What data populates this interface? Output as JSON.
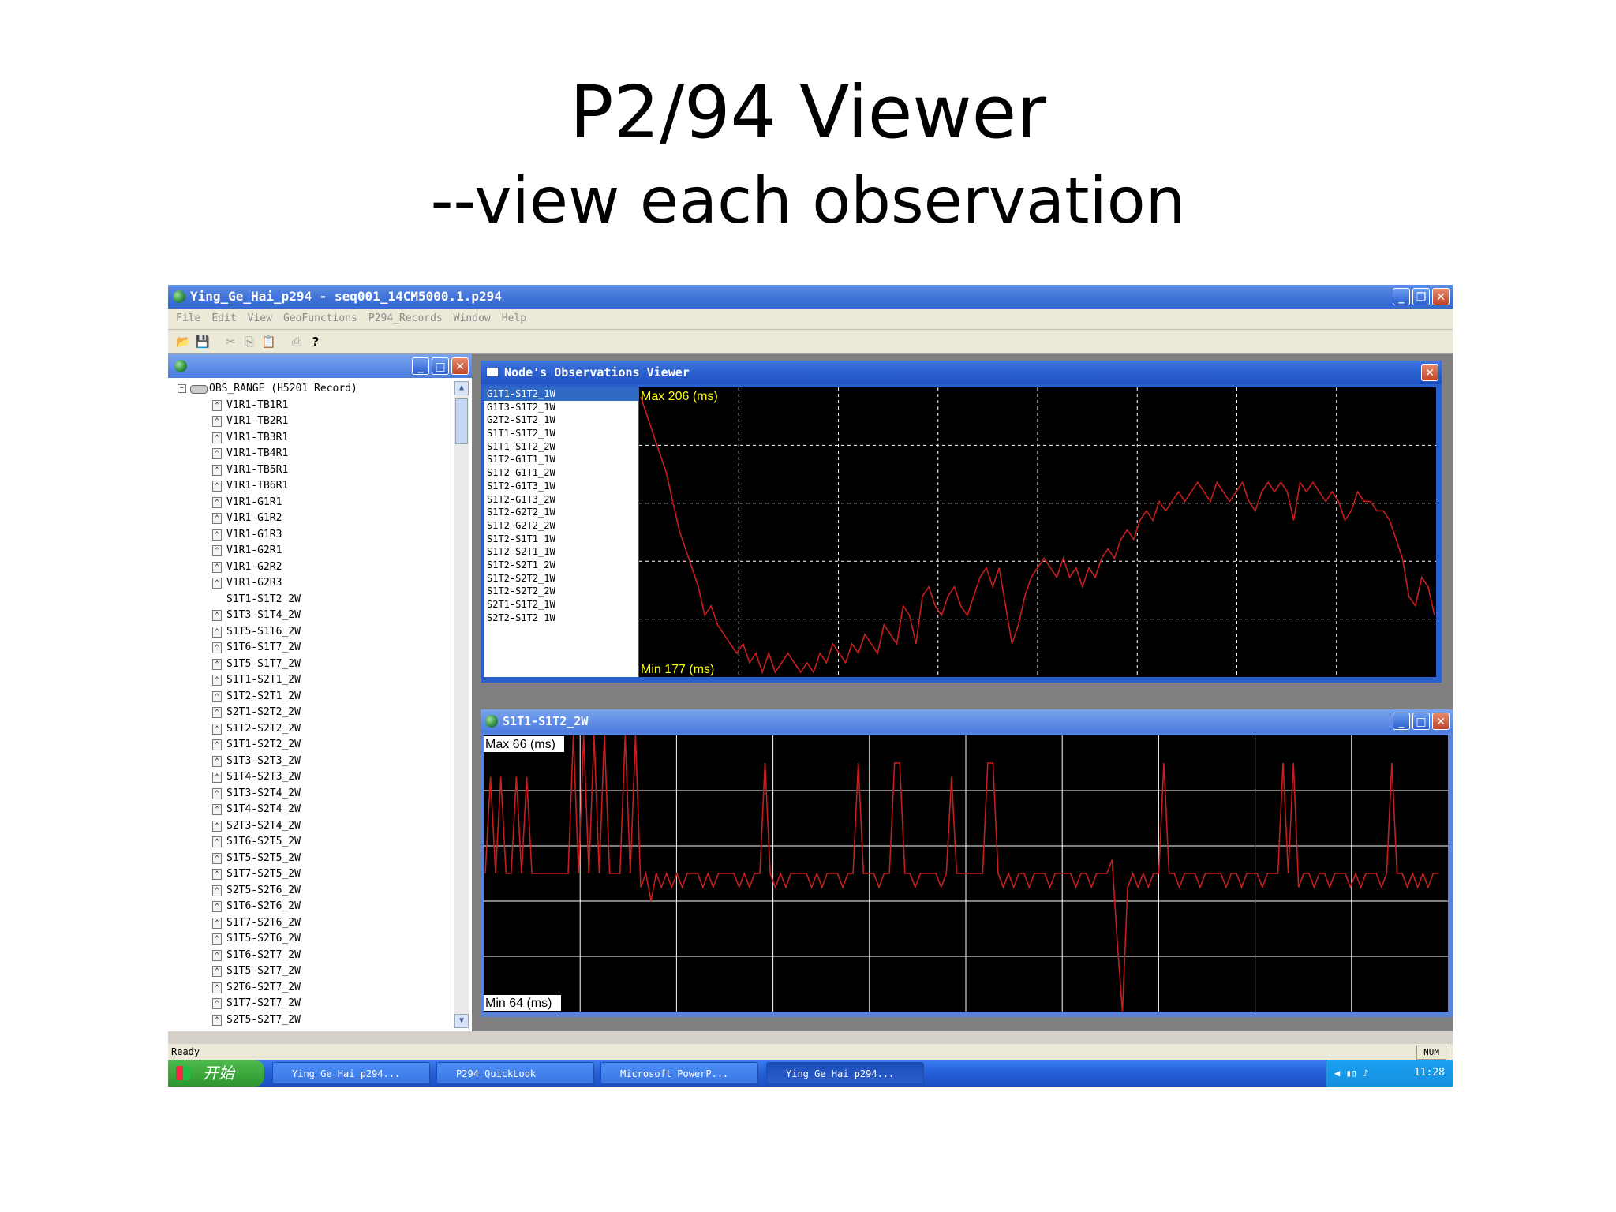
{
  "slide": {
    "title": "P2/94 Viewer",
    "subtitle": "--view each observation"
  },
  "app": {
    "title": "Ying_Ge_Hai_p294 - seq001_14CM5000.1.p294",
    "menu": [
      "File",
      "Edit",
      "View",
      "GeoFunctions",
      "P294_Records",
      "Window",
      "Help"
    ],
    "status": "Ready",
    "status_indicator": "NUM"
  },
  "tree": {
    "root": "OBS_RANGE (H5201 Record)",
    "items": [
      {
        "label": "V1R1-TB1R1",
        "icon": true
      },
      {
        "label": "V1R1-TB2R1",
        "icon": true
      },
      {
        "label": "V1R1-TB3R1",
        "icon": true
      },
      {
        "label": "V1R1-TB4R1",
        "icon": true
      },
      {
        "label": "V1R1-TB5R1",
        "icon": true
      },
      {
        "label": "V1R1-TB6R1",
        "icon": true
      },
      {
        "label": "V1R1-G1R1",
        "icon": true
      },
      {
        "label": "V1R1-G1R2",
        "icon": true
      },
      {
        "label": "V1R1-G1R3",
        "icon": true
      },
      {
        "label": "V1R1-G2R1",
        "icon": true
      },
      {
        "label": "V1R1-G2R2",
        "icon": true
      },
      {
        "label": "V1R1-G2R3",
        "icon": true
      },
      {
        "label": "S1T1-S1T2_2W",
        "icon": false
      },
      {
        "label": "S1T3-S1T4_2W",
        "icon": true
      },
      {
        "label": "S1T5-S1T6_2W",
        "icon": true
      },
      {
        "label": "S1T6-S1T7_2W",
        "icon": true
      },
      {
        "label": "S1T5-S1T7_2W",
        "icon": true
      },
      {
        "label": "S1T1-S2T1_2W",
        "icon": true
      },
      {
        "label": "S1T2-S2T1_2W",
        "icon": true
      },
      {
        "label": "S2T1-S2T2_2W",
        "icon": true
      },
      {
        "label": "S1T2-S2T2_2W",
        "icon": true
      },
      {
        "label": "S1T1-S2T2_2W",
        "icon": true
      },
      {
        "label": "S1T3-S2T3_2W",
        "icon": true
      },
      {
        "label": "S1T4-S2T3_2W",
        "icon": true
      },
      {
        "label": "S1T3-S2T4_2W",
        "icon": true
      },
      {
        "label": "S1T4-S2T4_2W",
        "icon": true
      },
      {
        "label": "S2T3-S2T4_2W",
        "icon": true
      },
      {
        "label": "S1T6-S2T5_2W",
        "icon": true
      },
      {
        "label": "S1T5-S2T5_2W",
        "icon": true
      },
      {
        "label": "S1T7-S2T5_2W",
        "icon": true
      },
      {
        "label": "S2T5-S2T6_2W",
        "icon": true
      },
      {
        "label": "S1T6-S2T6_2W",
        "icon": true
      },
      {
        "label": "S1T7-S2T6_2W",
        "icon": true
      },
      {
        "label": "S1T5-S2T6_2W",
        "icon": true
      },
      {
        "label": "S1T6-S2T7_2W",
        "icon": true
      },
      {
        "label": "S1T5-S2T7_2W",
        "icon": true
      },
      {
        "label": "S2T6-S2T7_2W",
        "icon": true
      },
      {
        "label": "S1T7-S2T7_2W",
        "icon": true
      },
      {
        "label": "S2T5-S2T7_2W",
        "icon": true
      }
    ]
  },
  "node_viewer": {
    "title": "Node's Observations Viewer",
    "list": [
      "G1T1-S1T2_1W",
      "G1T3-S1T2_1W",
      "G2T2-S1T2_1W",
      "S1T1-S1T2_1W",
      "S1T1-S1T2_2W",
      "S1T2-G1T1_1W",
      "S1T2-G1T1_2W",
      "S1T2-G1T3_1W",
      "S1T2-G1T3_2W",
      "S1T2-G2T2_1W",
      "S1T2-G2T2_2W",
      "S1T2-S1T1_1W",
      "S1T2-S2T1_1W",
      "S1T2-S2T1_2W",
      "S1T2-S2T2_1W",
      "S1T2-S2T2_2W",
      "S2T1-S1T2_1W",
      "S2T2-S1T2_1W"
    ],
    "selected_index": 0
  },
  "obs_window": {
    "title": "S1T1-S1T2_2W"
  },
  "chart_data": [
    {
      "type": "line",
      "max_label": "Max 206 (ms)",
      "min_label": "Min 177 (ms)",
      "ylim": [
        177,
        206
      ],
      "grid": true,
      "color": "#c81e1e",
      "values": [
        206,
        204,
        202,
        200,
        198,
        195,
        192,
        190,
        188,
        186,
        183,
        184,
        182,
        181,
        180,
        179,
        180,
        178,
        179,
        177,
        179,
        177,
        178,
        179,
        178,
        177,
        178,
        177,
        179,
        178,
        180,
        179,
        178,
        180,
        179,
        181,
        180,
        179,
        182,
        181,
        180,
        184,
        183,
        180,
        185,
        186,
        184,
        183,
        185,
        186,
        184,
        183,
        185,
        187,
        188,
        186,
        188,
        184,
        180,
        182,
        185,
        187,
        188,
        189,
        188,
        187,
        189,
        187,
        188,
        186,
        188,
        187,
        189,
        190,
        189,
        191,
        192,
        191,
        193,
        194,
        193,
        195,
        194,
        195,
        196,
        195,
        196,
        197,
        196,
        195,
        197,
        196,
        195,
        196,
        197,
        195,
        194,
        196,
        197,
        196,
        197,
        196,
        193,
        197,
        196,
        197,
        196,
        195,
        196,
        195,
        193,
        194,
        196,
        195,
        195,
        194,
        194,
        193,
        191,
        189,
        185,
        184,
        187,
        186,
        183
      ],
      "palette": {
        "max": "#ffff00",
        "min": "#ffff00"
      }
    },
    {
      "type": "line",
      "max_label": "Max 66 (ms)",
      "min_label": "Min 64 (ms)",
      "ylim": [
        64,
        66
      ],
      "grid": true,
      "color": "#c81e1e",
      "values": [
        65.0,
        65.7,
        65.0,
        65.7,
        65.0,
        65.0,
        65.7,
        65.0,
        65.7,
        65.0,
        65.0,
        65.0,
        65.0,
        65.0,
        65.0,
        65.0,
        65.0,
        66.0,
        65.0,
        66.0,
        65.0,
        66.0,
        65.0,
        66.0,
        65.0,
        65.0,
        65.0,
        66.0,
        65.0,
        66.0,
        64.9,
        65.0,
        64.8,
        65.0,
        64.9,
        65.0,
        64.9,
        65.0,
        64.9,
        65.0,
        65.0,
        65.0,
        64.9,
        65.0,
        64.9,
        65.0,
        65.0,
        65.0,
        65.0,
        64.9,
        65.0,
        64.9,
        65.0,
        65.0,
        65.8,
        65.0,
        64.9,
        65.0,
        64.9,
        65.0,
        65.0,
        65.0,
        65.0,
        64.9,
        65.0,
        64.9,
        65.0,
        65.0,
        65.0,
        64.9,
        65.0,
        65.0,
        65.8,
        65.0,
        65.0,
        65.0,
        64.9,
        65.0,
        65.0,
        65.8,
        65.8,
        65.0,
        65.0,
        64.9,
        65.0,
        65.0,
        65.0,
        65.0,
        64.9,
        65.0,
        65.7,
        65.0,
        65.0,
        65.0,
        65.0,
        65.0,
        65.0,
        65.8,
        65.8,
        65.0,
        64.9,
        65.0,
        64.9,
        65.0,
        65.0,
        64.9,
        65.0,
        65.0,
        65.0,
        64.9,
        65.0,
        65.0,
        65.0,
        65.0,
        64.9,
        65.0,
        65.0,
        64.9,
        65.0,
        65.0,
        65.0,
        65.1,
        64.5,
        64.0,
        64.9,
        65.0,
        64.9,
        65.0,
        64.9,
        65.0,
        65.0,
        65.8,
        65.0,
        65.0,
        64.9,
        65.0,
        65.0,
        65.0,
        64.9,
        65.0,
        65.0,
        65.0,
        65.0,
        64.9,
        65.0,
        65.0,
        64.9,
        65.0,
        65.0,
        65.0,
        64.9,
        65.0,
        65.0,
        65.0,
        65.8,
        65.0,
        65.8,
        64.9,
        65.0,
        65.0,
        64.9,
        65.0,
        65.0,
        64.9,
        65.0,
        65.0,
        65.0,
        64.9,
        65.0,
        64.9,
        65.0,
        65.0,
        65.0,
        64.9,
        65.0,
        65.8,
        65.0,
        65.0,
        64.9,
        65.0,
        64.9,
        65.0,
        64.9,
        65.0,
        65.0
      ],
      "palette": {
        "max": "#ffffff",
        "min": "#ffffff"
      }
    }
  ],
  "taskbar": {
    "start": "开始",
    "tasks": [
      "Ying_Ge_Hai_p294...",
      "P294_QuickLook",
      "Microsoft PowerP...",
      "Ying_Ge_Hai_p294..."
    ],
    "clock": "11:28"
  }
}
